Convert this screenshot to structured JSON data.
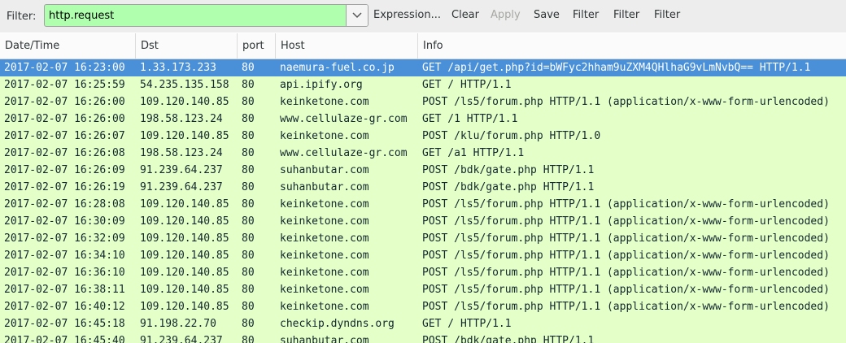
{
  "toolbar": {
    "filter_label": "Filter:",
    "filter_value": "http.request",
    "buttons": [
      {
        "label": "Expression...",
        "enabled": true
      },
      {
        "label": "Clear",
        "enabled": true
      },
      {
        "label": "Apply",
        "enabled": false
      },
      {
        "label": "Save",
        "enabled": true
      },
      {
        "label": "Filter",
        "enabled": true
      },
      {
        "label": "Filter",
        "enabled": true
      },
      {
        "label": "Filter",
        "enabled": true
      }
    ]
  },
  "columns": [
    "Date/Time",
    "Dst",
    "port",
    "Host",
    "Info"
  ],
  "colors": {
    "row_bg": "#e4ffc7",
    "selected_bg": "#4a90d9",
    "filter_valid_bg": "#afffaf"
  },
  "rows": [
    {
      "datetime": "2017-02-07 16:23:00",
      "dst": "1.33.173.233",
      "port": "80",
      "host": "naemura-fuel.co.jp",
      "info": "GET /api/get.php?id=bWFyc2hham9uZXM4QHlhaG9vLmNvbQ== HTTP/1.1",
      "selected": true
    },
    {
      "datetime": "2017-02-07 16:25:59",
      "dst": "54.235.135.158",
      "port": "80",
      "host": "api.ipify.org",
      "info": "GET / HTTP/1.1"
    },
    {
      "datetime": "2017-02-07 16:26:00",
      "dst": "109.120.140.85",
      "port": "80",
      "host": "keinketone.com",
      "info": "POST /ls5/forum.php HTTP/1.1  (application/x-www-form-urlencoded)"
    },
    {
      "datetime": "2017-02-07 16:26:00",
      "dst": "198.58.123.24",
      "port": "80",
      "host": "www.cellulaze-gr.com",
      "info": "GET /1 HTTP/1.1"
    },
    {
      "datetime": "2017-02-07 16:26:07",
      "dst": "109.120.140.85",
      "port": "80",
      "host": "keinketone.com",
      "info": "POST /klu/forum.php HTTP/1.0"
    },
    {
      "datetime": "2017-02-07 16:26:08",
      "dst": "198.58.123.24",
      "port": "80",
      "host": "www.cellulaze-gr.com",
      "info": "GET /a1 HTTP/1.1"
    },
    {
      "datetime": "2017-02-07 16:26:09",
      "dst": "91.239.64.237",
      "port": "80",
      "host": "suhanbutar.com",
      "info": "POST /bdk/gate.php HTTP/1.1"
    },
    {
      "datetime": "2017-02-07 16:26:19",
      "dst": "91.239.64.237",
      "port": "80",
      "host": "suhanbutar.com",
      "info": "POST /bdk/gate.php HTTP/1.1"
    },
    {
      "datetime": "2017-02-07 16:28:08",
      "dst": "109.120.140.85",
      "port": "80",
      "host": "keinketone.com",
      "info": "POST /ls5/forum.php HTTP/1.1  (application/x-www-form-urlencoded)"
    },
    {
      "datetime": "2017-02-07 16:30:09",
      "dst": "109.120.140.85",
      "port": "80",
      "host": "keinketone.com",
      "info": "POST /ls5/forum.php HTTP/1.1  (application/x-www-form-urlencoded)"
    },
    {
      "datetime": "2017-02-07 16:32:09",
      "dst": "109.120.140.85",
      "port": "80",
      "host": "keinketone.com",
      "info": "POST /ls5/forum.php HTTP/1.1  (application/x-www-form-urlencoded)"
    },
    {
      "datetime": "2017-02-07 16:34:10",
      "dst": "109.120.140.85",
      "port": "80",
      "host": "keinketone.com",
      "info": "POST /ls5/forum.php HTTP/1.1  (application/x-www-form-urlencoded)"
    },
    {
      "datetime": "2017-02-07 16:36:10",
      "dst": "109.120.140.85",
      "port": "80",
      "host": "keinketone.com",
      "info": "POST /ls5/forum.php HTTP/1.1  (application/x-www-form-urlencoded)"
    },
    {
      "datetime": "2017-02-07 16:38:11",
      "dst": "109.120.140.85",
      "port": "80",
      "host": "keinketone.com",
      "info": "POST /ls5/forum.php HTTP/1.1  (application/x-www-form-urlencoded)"
    },
    {
      "datetime": "2017-02-07 16:40:12",
      "dst": "109.120.140.85",
      "port": "80",
      "host": "keinketone.com",
      "info": "POST /ls5/forum.php HTTP/1.1  (application/x-www-form-urlencoded)"
    },
    {
      "datetime": "2017-02-07 16:45:18",
      "dst": "91.198.22.70",
      "port": "80",
      "host": "checkip.dyndns.org",
      "info": "GET / HTTP/1.1"
    },
    {
      "datetime": "2017-02-07 16:45:40",
      "dst": "91.239.64.237",
      "port": "80",
      "host": "suhanbutar.com",
      "info": "POST /bdk/gate.php HTTP/1.1"
    }
  ]
}
